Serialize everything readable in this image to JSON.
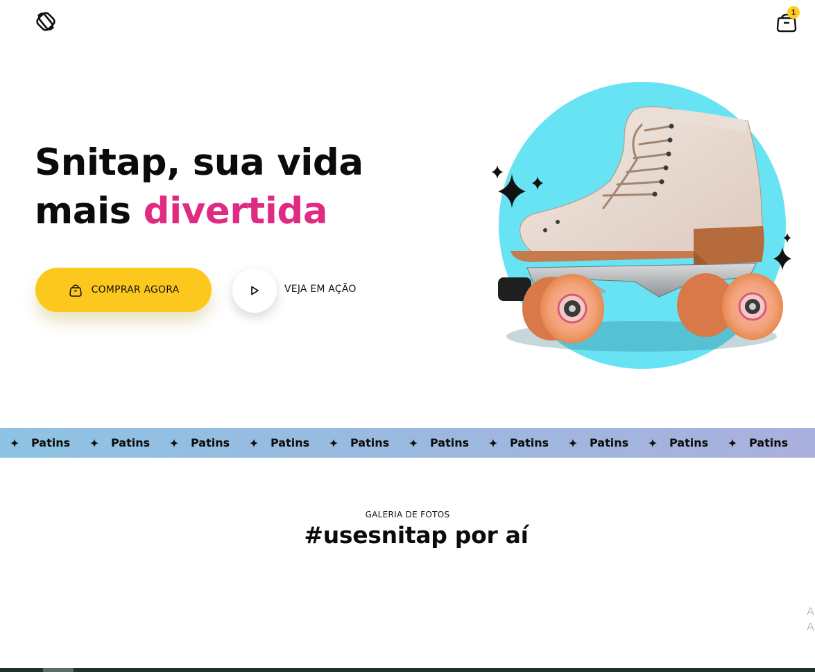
{
  "header": {
    "logo_icon": "snitap-logo-icon",
    "cart_icon": "shopping-bag-icon",
    "cart_count": "1"
  },
  "hero": {
    "title_line1": "Snitap, sua vida",
    "title_line2_prefix": "mais ",
    "title_line2_accent": "divertida",
    "accent_color": "#e02b83",
    "buy_button_label": "COMPRAR AGORA",
    "buy_button_icon": "shopping-bag-icon",
    "buy_button_color": "#fdc81e",
    "play_button_icon": "play-icon",
    "play_button_label": "VEJA EM AÇÃO",
    "image_icon": "roller-skate-image",
    "circle_color": "#67e3f4"
  },
  "marquee": {
    "icon": "sparkle-star-icon",
    "items": [
      "Patins",
      "Patins",
      "Patins",
      "Patins",
      "Patins",
      "Patins",
      "Patins",
      "Patins",
      "Patins",
      "Patins"
    ]
  },
  "gallery": {
    "eyebrow": "GALERIA DE FOTOS",
    "title": "#usesnitap por aí"
  },
  "edge_text": [
    "A",
    "A"
  ]
}
